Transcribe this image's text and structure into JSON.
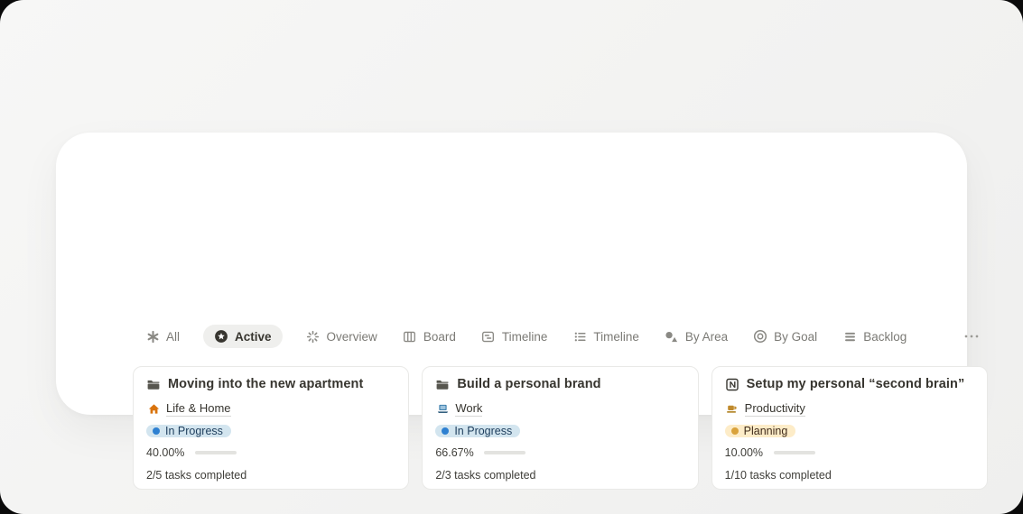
{
  "view_tabs": [
    {
      "label": "All",
      "icon": "asterisk-icon",
      "active": false
    },
    {
      "label": "Active",
      "icon": "star-circle-icon",
      "active": true
    },
    {
      "label": "Overview",
      "icon": "spinner-icon",
      "active": false
    },
    {
      "label": "Board",
      "icon": "board-columns-icon",
      "active": false
    },
    {
      "label": "Timeline",
      "icon": "page-lines-icon",
      "active": false
    },
    {
      "label": "Timeline",
      "icon": "bulleted-list-icon",
      "active": false
    },
    {
      "label": "By Area",
      "icon": "shapes-icon",
      "active": false
    },
    {
      "label": "By Goal",
      "icon": "target-icon",
      "active": false
    },
    {
      "label": "Backlog",
      "icon": "rows-icon",
      "active": false
    }
  ],
  "toolbar": {
    "more_icon": "more-ellipsis-icon"
  },
  "cards": [
    {
      "title": "Moving into the new apartment",
      "title_icon": "folder-icon",
      "area": {
        "label": "Life & Home",
        "icon": "house-icon"
      },
      "status": {
        "label": "In Progress",
        "bg": "#d3e5ef",
        "dot": "#2e80d1",
        "text": "#1d3d5c"
      },
      "progress": {
        "label": "40.00%",
        "value": 40
      },
      "tasks": "2/5 tasks completed"
    },
    {
      "title": "Build a personal brand",
      "title_icon": "folder-icon",
      "area": {
        "label": "Work",
        "icon": "laptop-icon"
      },
      "status": {
        "label": "In Progress",
        "bg": "#d3e5ef",
        "dot": "#2e80d1",
        "text": "#1d3d5c"
      },
      "progress": {
        "label": "66.67%",
        "value": 66.67
      },
      "tasks": "2/3 tasks completed"
    },
    {
      "title": "Setup my personal “second brain”",
      "title_icon": "notion-logo-icon",
      "area": {
        "label": "Productivity",
        "icon": "coffee-icon"
      },
      "status": {
        "label": "Planning",
        "bg": "#fdecc8",
        "dot": "#d9a23b",
        "text": "#402c1b"
      },
      "progress": {
        "label": "10.00%",
        "value": 10
      },
      "tasks": "1/10 tasks completed"
    }
  ],
  "colors": {
    "progress_fill": "#569168",
    "progress_track": "#e3e3e0",
    "active_tab_bg": "#efefed",
    "panel_bg": "#ffffff",
    "page_bg": "#f3f3f2",
    "tab_text": "#7b7a75",
    "title_text": "#37352f"
  }
}
